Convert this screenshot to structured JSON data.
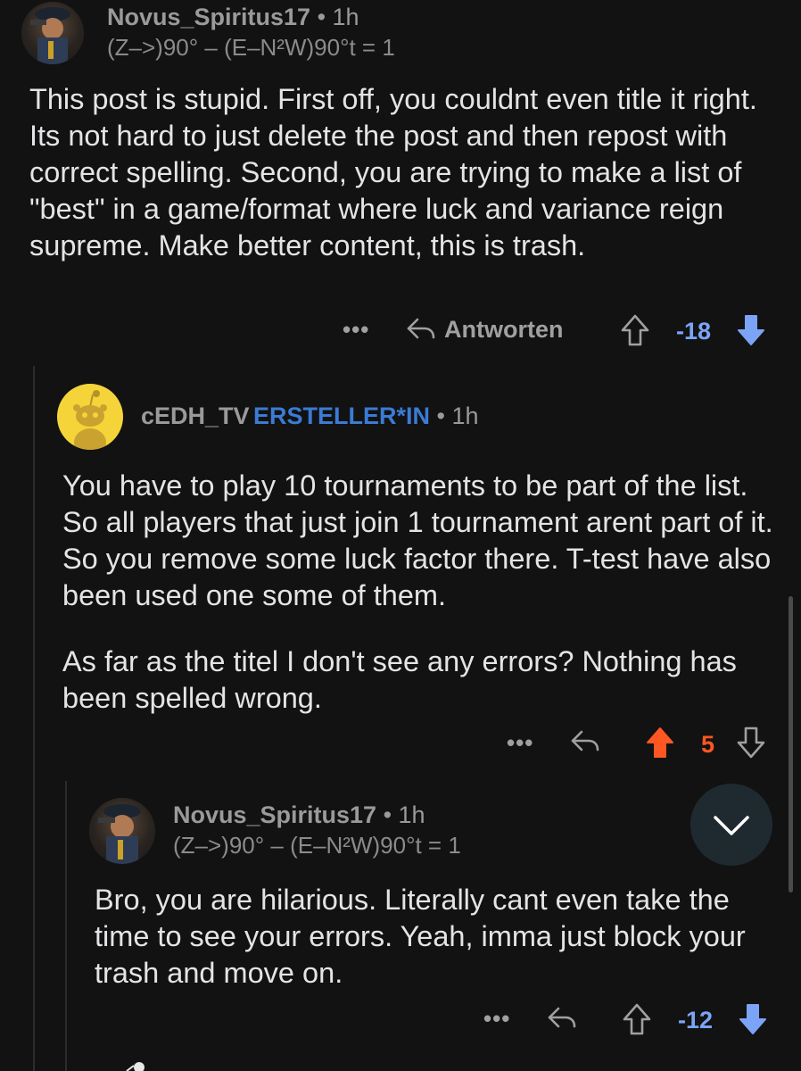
{
  "comments": [
    {
      "username": "Novus_Spiritus17",
      "meta": " • 1h",
      "flair": "(Z–>)90° – (E–N²W)90°t = 1",
      "paragraphs": [
        "This post is stupid. First off, you couldnt even title it right. Its not hard to just delete the post and then repost with correct spelling. Second, you are trying to make a list of \"best\" in a game/format where luck and variance reign supreme. Make better content, this is trash."
      ],
      "actions": {
        "more": "•••",
        "reply_label": "Antworten",
        "score": "-18",
        "vote_state": "downvoted"
      }
    },
    {
      "username": "cEDH_TV",
      "badge": "ERSTELLER*IN",
      "meta": " • 1h",
      "paragraphs": [
        "You have to play 10 tournaments to be part of the list. So all players that just join 1 tournament arent part of it. So you remove some luck factor there. T-test have also been used one some of them.",
        "As far as the titel I don't see any errors? Nothing has been spelled wrong."
      ],
      "actions": {
        "more": "•••",
        "score": "5",
        "vote_state": "upvoted"
      }
    },
    {
      "username": "Novus_Spiritus17",
      "meta": " • 1h",
      "flair": "(Z–>)90° – (E–N²W)90°t = 1",
      "paragraphs": [
        "Bro, you are hilarious. Literally cant even take the time to see your errors. Yeah, imma just block your trash and move on."
      ],
      "actions": {
        "more": "•••",
        "score": "-12",
        "vote_state": "downvoted"
      }
    }
  ],
  "colors": {
    "background": "#121212",
    "downvote": "#7ba4f7",
    "upvote": "#ff5722",
    "op_badge": "#3a7bd5"
  },
  "icons": {
    "reply": "reply-arrow-icon",
    "upvote": "upvote-arrow-icon",
    "downvote": "downvote-arrow-icon",
    "jump": "chevron-down-icon"
  }
}
